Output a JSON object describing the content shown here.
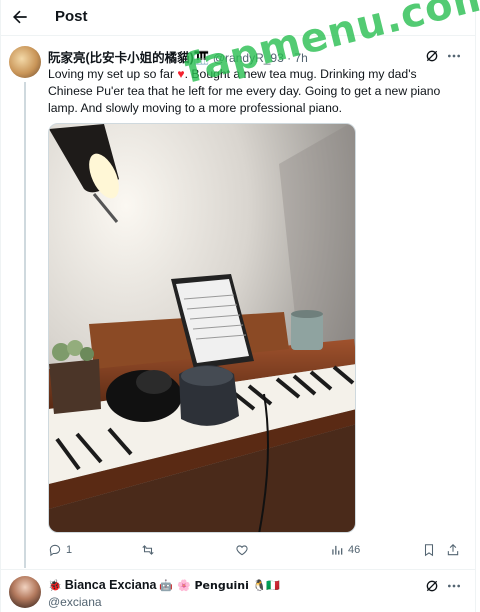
{
  "header": {
    "title": "Post"
  },
  "tweet": {
    "author_name": "阮家亮(比安卡小姐的橘貓)🎹",
    "handle": "@randyR_93",
    "separator": " · ",
    "time": "7h",
    "text_before_heart": "Loving my set up so far ",
    "heart": "♥",
    "text_after_heart": ". Bought a new tea mug. Drinking my dad's Chinese Pu'er tea that he left for me every day. Going to get a new piano lamp. And slowly moving to a more professional piano.",
    "actions": {
      "replies": "1",
      "reposts": "",
      "likes": "",
      "views": "46"
    }
  },
  "watermark": "fapmenu.com",
  "reply": {
    "author_name": "Bianca Exciana",
    "prefix_emoji": "🐞",
    "emoji_suffix": "🤖 🌸 Penguini 🐧🇮🇹",
    "handle": "@exciana"
  },
  "colors": {
    "accent_text": "#0f1419",
    "muted": "#536471",
    "heart": "#f4212e",
    "watermark": "#28be50"
  }
}
